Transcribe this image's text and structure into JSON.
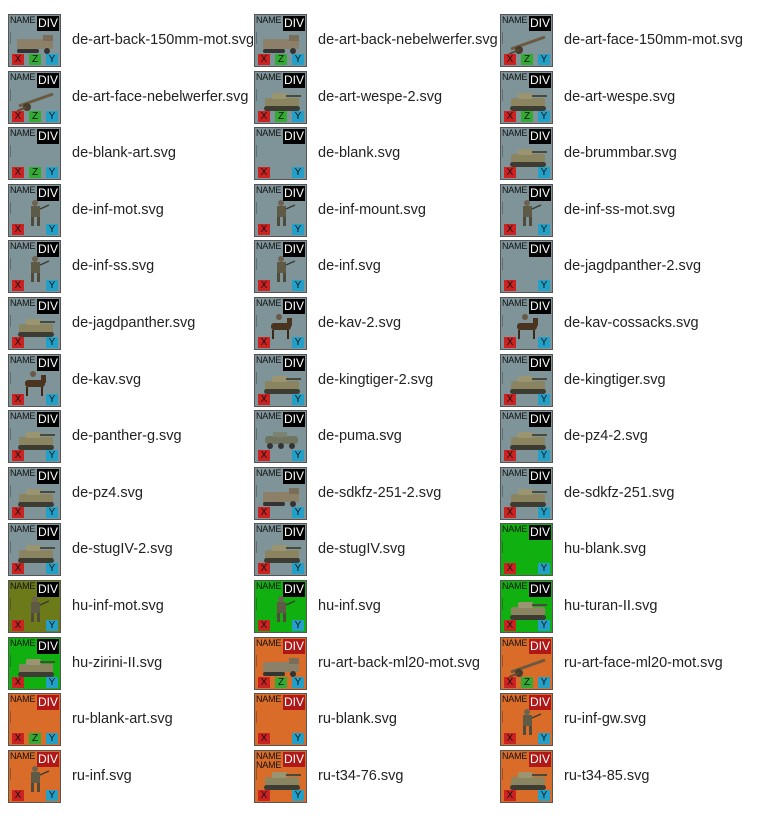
{
  "texts": {
    "name": "NAME",
    "div": "DIV",
    "x": "X",
    "z": "Z",
    "y": "Y"
  },
  "colors": {
    "de_bg": "#7e9499",
    "hu_green": "#10b010",
    "hu_olive": "#6c7a1a",
    "ru_orange": "#d96c28",
    "div_black": "#000000",
    "div_red": "#b01818"
  },
  "files": [
    {
      "label": "de-art-back-150mm-mot.svg",
      "nation": "de",
      "art": "halftrack",
      "name2": false,
      "z": true
    },
    {
      "label": "de-art-back-nebelwerfer.svg",
      "nation": "de",
      "art": "halftrack",
      "name2": false,
      "z": true
    },
    {
      "label": "de-art-face-150mm-mot.svg",
      "nation": "de",
      "art": "gun",
      "name2": false,
      "z": true
    },
    {
      "label": "de-art-face-nebelwerfer.svg",
      "nation": "de",
      "art": "gun",
      "name2": false,
      "z": true
    },
    {
      "label": "de-art-wespe-2.svg",
      "nation": "de",
      "art": "tank",
      "name2": false,
      "z": true
    },
    {
      "label": "de-art-wespe.svg",
      "nation": "de",
      "art": "tank",
      "name2": false,
      "z": true
    },
    {
      "label": "de-blank-art.svg",
      "nation": "de",
      "art": "none",
      "name2": false,
      "z": true
    },
    {
      "label": "de-blank.svg",
      "nation": "de",
      "art": "none",
      "name2": false,
      "z": false
    },
    {
      "label": "de-brummbar.svg",
      "nation": "de",
      "art": "tank",
      "name2": false,
      "z": false
    },
    {
      "label": "de-inf-mot.svg",
      "nation": "de",
      "art": "soldier",
      "name2": false,
      "z": false
    },
    {
      "label": "de-inf-mount.svg",
      "nation": "de",
      "art": "soldier",
      "name2": false,
      "z": false
    },
    {
      "label": "de-inf-ss-mot.svg",
      "nation": "de",
      "art": "soldier",
      "name2": false,
      "z": false
    },
    {
      "label": "de-inf-ss.svg",
      "nation": "de",
      "art": "soldier",
      "name2": false,
      "z": false
    },
    {
      "label": "de-inf.svg",
      "nation": "de",
      "art": "soldier",
      "name2": false,
      "z": false
    },
    {
      "label": "de-jagdpanther-2.svg",
      "nation": "de",
      "art": "none",
      "name2": false,
      "z": false
    },
    {
      "label": "de-jagdpanther.svg",
      "nation": "de",
      "art": "tank",
      "name2": false,
      "z": false
    },
    {
      "label": "de-kav-2.svg",
      "nation": "de",
      "art": "horse",
      "name2": false,
      "z": false
    },
    {
      "label": "de-kav-cossacks.svg",
      "nation": "de",
      "art": "horse",
      "name2": false,
      "z": false
    },
    {
      "label": "de-kav.svg",
      "nation": "de",
      "art": "horse",
      "name2": false,
      "z": false
    },
    {
      "label": "de-kingtiger-2.svg",
      "nation": "de",
      "art": "tank",
      "name2": false,
      "z": false
    },
    {
      "label": "de-kingtiger.svg",
      "nation": "de",
      "art": "tank",
      "name2": false,
      "z": false
    },
    {
      "label": "de-panther-g.svg",
      "nation": "de",
      "art": "tank",
      "name2": false,
      "z": false
    },
    {
      "label": "de-puma.svg",
      "nation": "de",
      "art": "car",
      "name2": false,
      "z": false
    },
    {
      "label": "de-pz4-2.svg",
      "nation": "de",
      "art": "tank",
      "name2": false,
      "z": false
    },
    {
      "label": "de-pz4.svg",
      "nation": "de",
      "art": "tank",
      "name2": false,
      "z": false
    },
    {
      "label": "de-sdkfz-251-2.svg",
      "nation": "de",
      "art": "halftrack",
      "name2": false,
      "z": false
    },
    {
      "label": "de-sdkfz-251.svg",
      "nation": "de",
      "art": "tank",
      "name2": false,
      "z": false
    },
    {
      "label": "de-stugIV-2.svg",
      "nation": "de",
      "art": "tank",
      "name2": false,
      "z": false
    },
    {
      "label": "de-stugIV.svg",
      "nation": "de",
      "art": "tank",
      "name2": false,
      "z": false
    },
    {
      "label": "hu-blank.svg",
      "nation": "hu",
      "art": "none",
      "name2": false,
      "z": false
    },
    {
      "label": "hu-inf-mot.svg",
      "nation": "hu-olive",
      "art": "soldier",
      "name2": false,
      "z": false
    },
    {
      "label": "hu-inf.svg",
      "nation": "hu",
      "art": "soldier",
      "name2": false,
      "z": false
    },
    {
      "label": "hu-turan-II.svg",
      "nation": "hu",
      "art": "tank",
      "name2": false,
      "z": false
    },
    {
      "label": "hu-zirini-II.svg",
      "nation": "hu",
      "art": "tank",
      "name2": false,
      "z": false
    },
    {
      "label": "ru-art-back-ml20-mot.svg",
      "nation": "ru",
      "art": "halftrack",
      "name2": false,
      "z": true
    },
    {
      "label": "ru-art-face-ml20-mot.svg",
      "nation": "ru",
      "art": "gun",
      "name2": false,
      "z": true
    },
    {
      "label": "ru-blank-art.svg",
      "nation": "ru",
      "art": "none",
      "name2": false,
      "z": true
    },
    {
      "label": "ru-blank.svg",
      "nation": "ru",
      "art": "none",
      "name2": false,
      "z": false
    },
    {
      "label": "ru-inf-gw.svg",
      "nation": "ru",
      "art": "soldier",
      "name2": false,
      "z": false
    },
    {
      "label": "ru-inf.svg",
      "nation": "ru",
      "art": "soldier",
      "name2": false,
      "z": false
    },
    {
      "label": "ru-t34-76.svg",
      "nation": "ru",
      "art": "tank",
      "name2": true,
      "z": false
    },
    {
      "label": "ru-t34-85.svg",
      "nation": "ru",
      "art": "tank",
      "name2": false,
      "z": false
    }
  ]
}
